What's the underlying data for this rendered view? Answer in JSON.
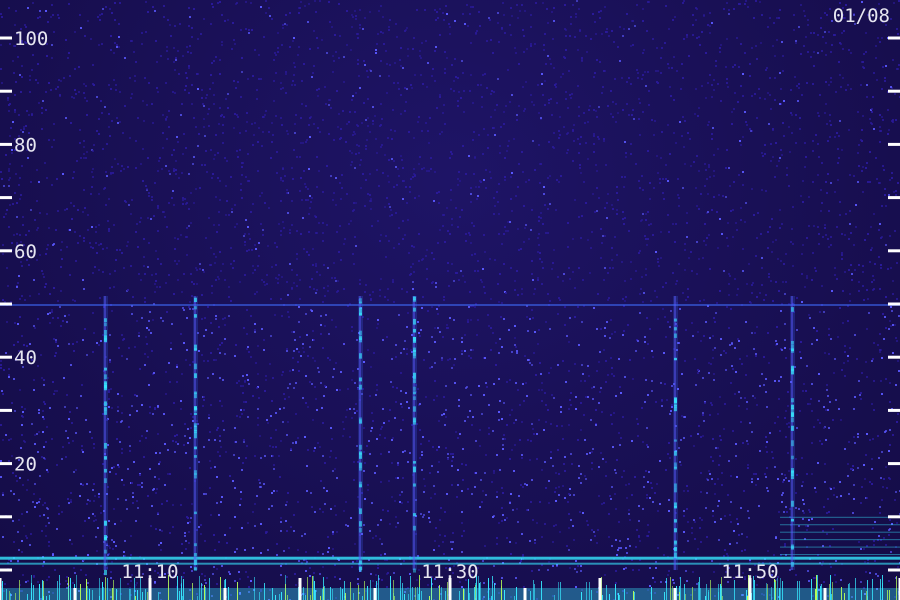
{
  "chart_data": {
    "type": "heatmap",
    "date": "01/08",
    "yticks": [
      100,
      80,
      60,
      40,
      20
    ],
    "ylim": [
      0,
      105
    ],
    "xlim_minutes": [
      660,
      720
    ],
    "xtick_labels": [
      "11:10",
      "11:30",
      "11:50"
    ],
    "xtick_minutes": [
      670,
      690,
      710
    ],
    "vertical_bursts_minutes": [
      667,
      673,
      684,
      687.6,
      705,
      712.8
    ],
    "burst_top_value": 50,
    "grid": false,
    "colors": {
      "background": "#180f52",
      "noise_low": "#2a1a9a",
      "noise_high": "#5a58ff",
      "band": "#3f6dff",
      "low_band": "#37e8ff",
      "low_band_hot": "#b8ff5a",
      "tick": "#ffffff"
    }
  }
}
